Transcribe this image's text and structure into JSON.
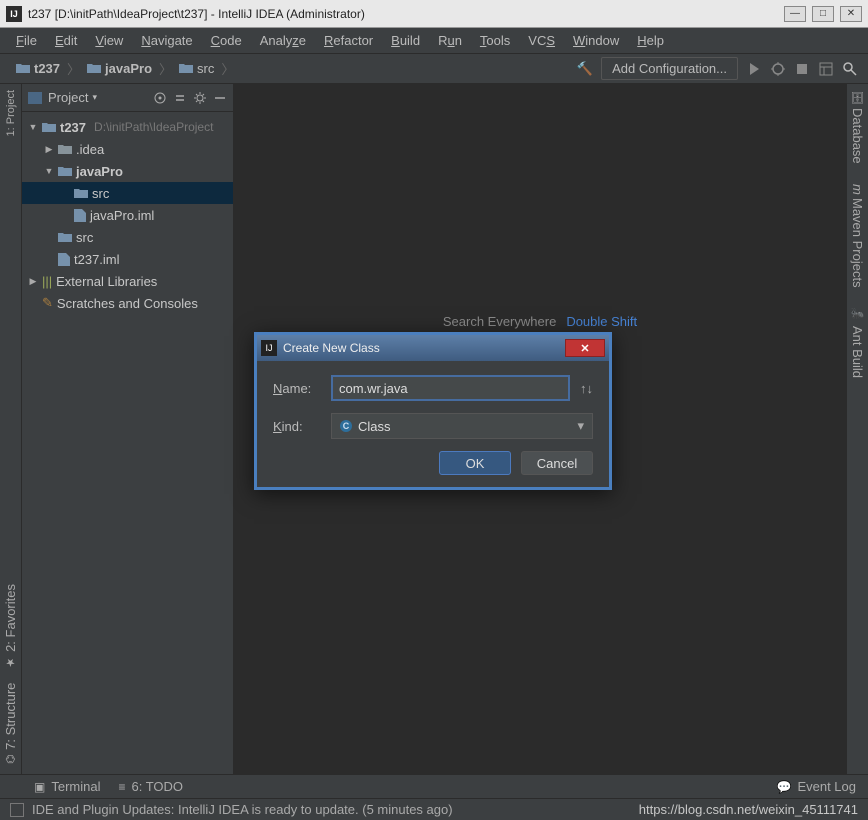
{
  "window": {
    "title": "t237 [D:\\initPath\\IdeaProject\\t237] - IntelliJ IDEA (Administrator)"
  },
  "menu": [
    "File",
    "Edit",
    "View",
    "Navigate",
    "Code",
    "Analyze",
    "Refactor",
    "Build",
    "Run",
    "Tools",
    "VCS",
    "Window",
    "Help"
  ],
  "breadcrumb": [
    "t237",
    "javaPro",
    "src"
  ],
  "toolbar": {
    "add_config": "Add Configuration..."
  },
  "project_panel": {
    "title": "Project"
  },
  "tree": {
    "root": {
      "label": "t237",
      "path": "D:\\initPath\\IdeaProject"
    },
    "idea": ".idea",
    "javaPro": "javaPro",
    "src_inner": "src",
    "javaPro_iml": "javaPro.iml",
    "src": "src",
    "t237_iml": "t237.iml",
    "ext_libs": "External Libraries",
    "scratches": "Scratches and Consoles"
  },
  "left_labels": {
    "project": "1: Project",
    "favorites": "2: Favorites",
    "structure": "7: Structure"
  },
  "right_labels": {
    "database": "Database",
    "maven": "Maven Projects",
    "ant": "Ant Build"
  },
  "editor_hint": {
    "label": "Search Everywhere",
    "key": "Double Shift"
  },
  "dialog": {
    "title": "Create New Class",
    "name_label": "Name:",
    "name_value": "com.wr.java",
    "kind_label": "Kind:",
    "kind_value": "Class",
    "ok": "OK",
    "cancel": "Cancel"
  },
  "bottom": {
    "terminal": "Terminal",
    "todo": "6: TODO",
    "event_log": "Event Log"
  },
  "status": {
    "message": "IDE and Plugin Updates: IntelliJ IDEA is ready to update. (5 minutes ago)",
    "watermark": "https://blog.csdn.net/weixin_45111741"
  }
}
